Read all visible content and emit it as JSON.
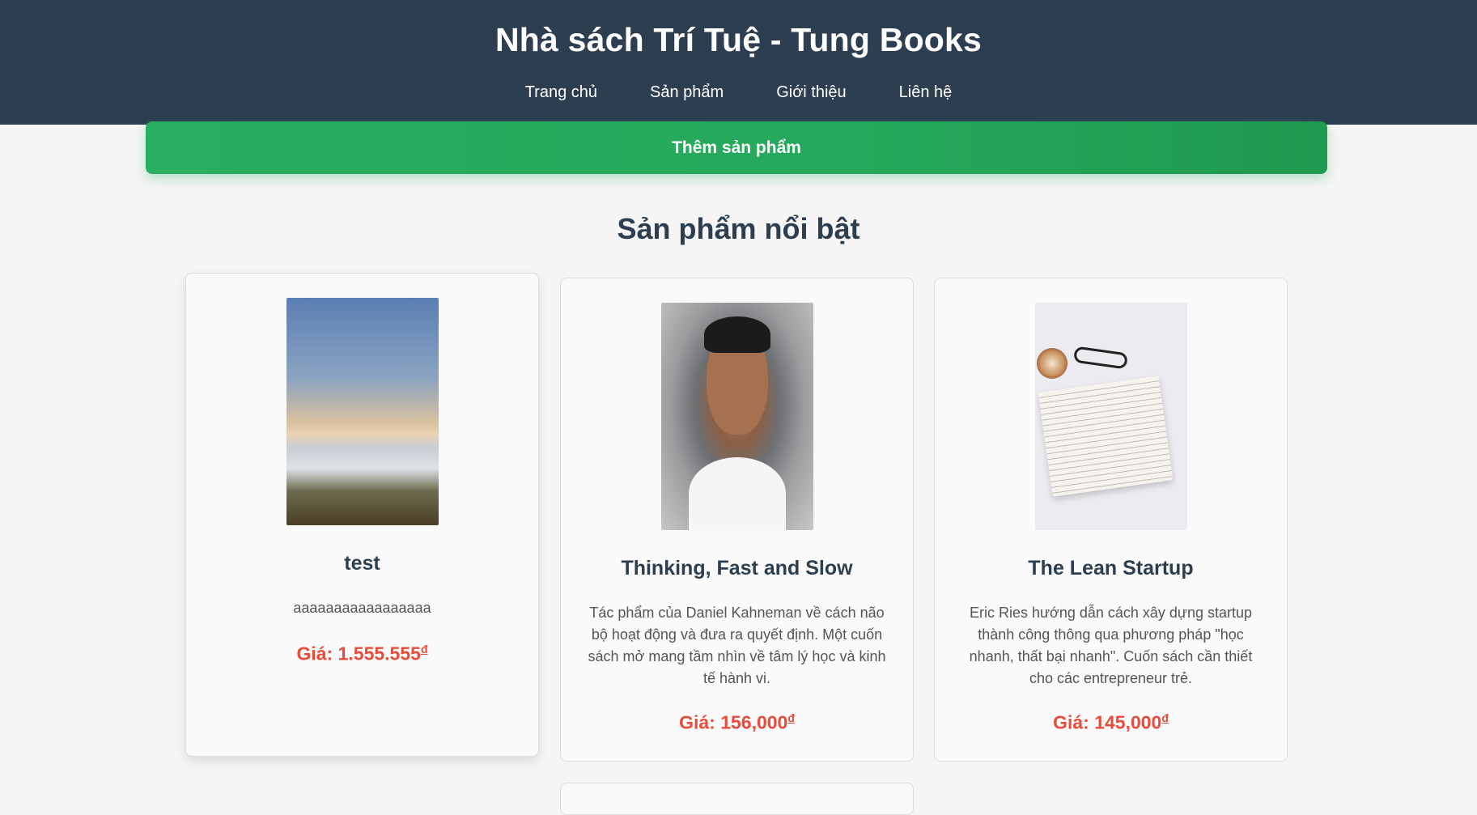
{
  "header": {
    "title": "Nhà sách Trí Tuệ - Tung Books",
    "nav": [
      "Trang chủ",
      "Sản phẩm",
      "Giới thiệu",
      "Liên hệ"
    ]
  },
  "actions": {
    "add_product_label": "Thêm sản phẩm"
  },
  "section": {
    "title": "Sản phẩm nổi bật"
  },
  "products": [
    {
      "title": "test",
      "description": "aaaaaaaaaaaaaaaaa",
      "price_label": "Giá: 1.555.555",
      "currency": "đ",
      "image": "mountain-landscape-photo"
    },
    {
      "title": "Thinking, Fast and Slow",
      "description": "Tác phẩm của Daniel Kahneman về cách não bộ hoạt động và đưa ra quyết định. Một cuốn sách mở mang tầm nhìn về tâm lý học và kinh tế hành vi.",
      "price_label": "Giá: 156,000",
      "currency": "đ",
      "image": "portrait-photo"
    },
    {
      "title": "The Lean Startup",
      "description": "Eric Ries hướng dẫn cách xây dựng startup thành công thông qua phương pháp \"học nhanh, thất bại nhanh\". Cuốn sách cần thiết cho các entrepreneur trẻ.",
      "price_label": "Giá: 145,000",
      "currency": "đ",
      "image": "open-book-coffee-photo"
    }
  ],
  "colors": {
    "header_bg": "#2c3e50",
    "accent_green": "#27ae60",
    "price_red": "#e74c3c",
    "title_dark": "#2c3e50"
  }
}
